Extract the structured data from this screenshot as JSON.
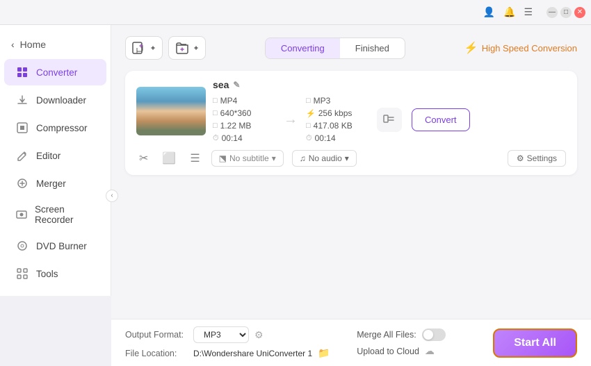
{
  "titlebar": {
    "user_icon": "👤",
    "bell_icon": "🔔",
    "minimize_label": "—",
    "maximize_label": "□",
    "close_label": "✕"
  },
  "sidebar": {
    "home_label": "Home",
    "items": [
      {
        "id": "converter",
        "label": "Converter",
        "icon": "⧉",
        "active": true
      },
      {
        "id": "downloader",
        "label": "Downloader",
        "icon": "⬇"
      },
      {
        "id": "compressor",
        "label": "Compressor",
        "icon": "⊞"
      },
      {
        "id": "editor",
        "label": "Editor",
        "icon": "✎"
      },
      {
        "id": "merger",
        "label": "Merger",
        "icon": "⊕"
      },
      {
        "id": "screen-recorder",
        "label": "Screen Recorder",
        "icon": "⏺"
      },
      {
        "id": "dvd-burner",
        "label": "DVD Burner",
        "icon": "💿"
      },
      {
        "id": "tools",
        "label": "Tools",
        "icon": "⊞"
      }
    ]
  },
  "topbar": {
    "add_btn_icon": "📄",
    "settings_btn_icon": "⚙",
    "converting_tab": "Converting",
    "finished_tab": "Finished",
    "high_speed_label": "High Speed Conversion",
    "active_tab": "converting"
  },
  "file_card": {
    "filename": "sea",
    "source": {
      "format": "MP4",
      "resolution": "640*360",
      "size": "1.22 MB",
      "duration": "00:14"
    },
    "target": {
      "format": "MP3",
      "bitrate": "256 kbps",
      "size": "417.08 KB",
      "duration": "00:14"
    },
    "subtitle_placeholder": "No subtitle",
    "audio_label": "No audio",
    "settings_label": "Settings",
    "convert_btn_label": "Convert"
  },
  "bottombar": {
    "output_format_label": "Output Format:",
    "output_format_value": "MP3",
    "file_location_label": "File Location:",
    "file_location_value": "D:\\Wondershare UniConverter 1",
    "merge_files_label": "Merge All Files:",
    "upload_cloud_label": "Upload to Cloud",
    "start_all_label": "Start All"
  }
}
